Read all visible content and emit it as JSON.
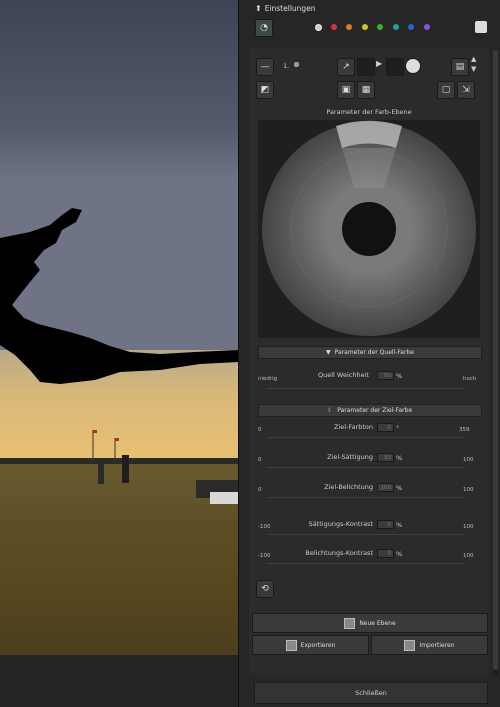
{
  "header": {
    "title": "Einstellungen",
    "arrow_icon": "arrow-up-icon"
  },
  "color_dots": [
    "#cccccc",
    "#e03030",
    "#e07a20",
    "#d8c020",
    "#3ab030",
    "#20a0a0",
    "#3060e0",
    "#8a50e0"
  ],
  "layer": {
    "index": "1."
  },
  "color_layer_title": "Parameter der Farb-Ebene",
  "source_section": {
    "title": "Parameter der Quell-Farbe",
    "low_label": "niedrig",
    "high_label": "hoch",
    "softness_label": "Quell Weichheit",
    "softness_value": "50",
    "softness_unit": "%"
  },
  "target_section": {
    "title": "Parameter der Ziel-Farbe",
    "rows": [
      {
        "label": "Ziel-Farbton",
        "value": "0",
        "unit": "°",
        "min": "0",
        "max": "359"
      },
      {
        "label": "Ziel-Sättigung",
        "value": "50",
        "unit": "%",
        "min": "0",
        "max": "100"
      },
      {
        "label": "Ziel-Belichtung",
        "value": "100",
        "unit": "%",
        "min": "0",
        "max": "100"
      },
      {
        "label": "Sättigungs-Kontrast",
        "value": "0",
        "unit": "%",
        "min": "-100",
        "max": "100"
      },
      {
        "label": "Belichtungs-Kontrast",
        "value": "0",
        "unit": "%",
        "min": "-100",
        "max": "100"
      }
    ]
  },
  "buttons": {
    "new_layer": "Neue Ebene",
    "export": "Exportieren",
    "import": "Importieren",
    "close": "Schließen"
  }
}
